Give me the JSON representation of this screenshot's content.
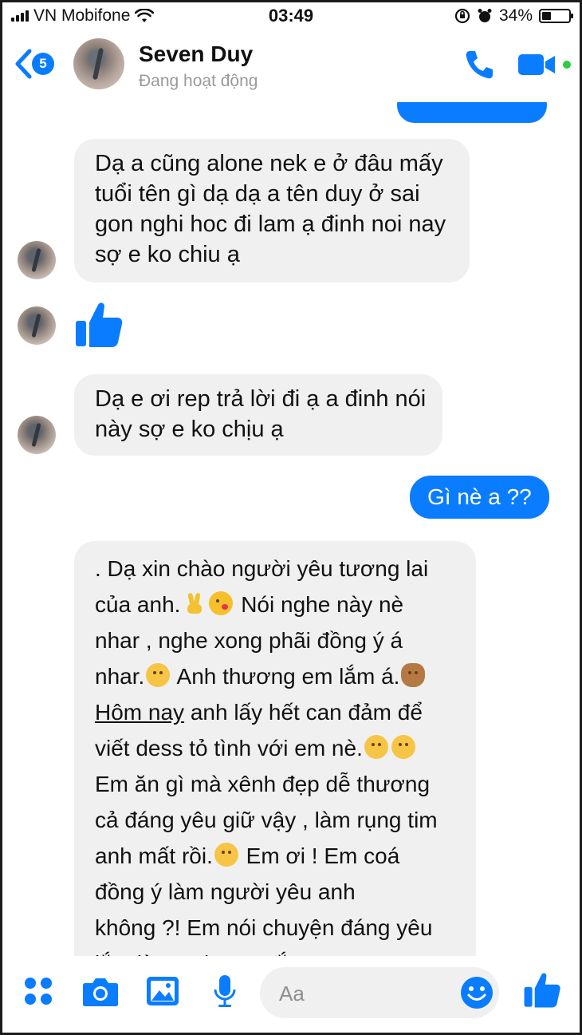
{
  "status_bar": {
    "carrier": "VN Mobifone",
    "time": "03:49",
    "battery_percent": "34%",
    "battery_level": 0.34
  },
  "header": {
    "back_badge_count": "5",
    "contact_name": "Seven Duy",
    "contact_status": "Đang hoạt động"
  },
  "messages": [
    {
      "direction": "incoming",
      "lines": [
        "Dạ a cũng alone nek e ở đâu mấy",
        "tuổi tên gì dạ dạ a tên duy ở sai",
        "gon nghi hoc đi lam ạ đinh noi nay",
        "sợ e ko chiu ạ"
      ]
    },
    {
      "direction": "incoming",
      "type": "like"
    },
    {
      "direction": "incoming",
      "lines": [
        "Dạ e ơi rep trả lời đi ạ a đinh nói",
        "này sợ e ko chịu ạ"
      ]
    },
    {
      "direction": "outgoing",
      "text": "Gì nè a ??"
    },
    {
      "direction": "incoming",
      "segments": {
        "l1": ". Dạ xin chào người yêu tương lai",
        "l2a": "của anh.",
        "l2b": " Nói nghe này nè",
        "l3": "nhar , nghe xong phãi đồng ý á",
        "l4a": "nhar.",
        "l4b": " Anh thương em lắm á.",
        "l5a": "Hôm nay",
        "l5b": " anh lấy hết can đảm để",
        "l6": "viết dess tỏ tình với em nè.",
        "l7": "Em ăn gì mà xênh đẹp dễ thương",
        "l8": "cả đáng yêu giữ vậy , làm rụng tim",
        "l9a": "anh mất rồi.",
        "l9b": " Em ơi ! Em coá",
        "l10": "đồng ý làm người yêu anh",
        "l11": "không ?! Em nói chuyện đáng yêu",
        "l12": "lắm làm anh say nắng , say mưa"
      },
      "emojis": [
        "victory-hand",
        "face-blowing-kiss",
        "smiling-face",
        "see-no-evil-monkey",
        "smiling-face",
        "smiling-face"
      ]
    }
  ],
  "composer": {
    "placeholder": "Aa"
  },
  "colors": {
    "messenger_blue": "#0a7cff",
    "incoming_bubble": "#f1f0f0",
    "online_green": "#2ecc40"
  }
}
